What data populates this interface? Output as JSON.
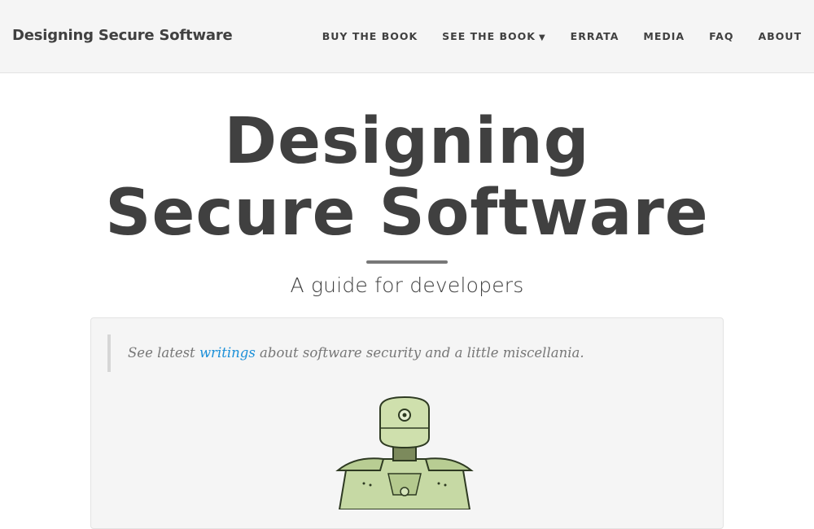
{
  "navbar": {
    "brand": "Designing Secure Software",
    "items": [
      {
        "label": "BUY THE BOOK"
      },
      {
        "label": "SEE THE BOOK",
        "caret": "▼"
      },
      {
        "label": "ERRATA"
      },
      {
        "label": "MEDIA"
      },
      {
        "label": "FAQ"
      },
      {
        "label": "ABOUT"
      }
    ]
  },
  "hero": {
    "title": "Designing Secure Software",
    "subtitle": "A guide for developers"
  },
  "card": {
    "quote_prefix": "See latest ",
    "quote_link": "writings",
    "quote_suffix": " about software security and a little miscellania."
  },
  "colors": {
    "navbar_bg": "#f5f5f5",
    "text": "#404040",
    "link": "#1a8fd8",
    "robot_green": "#c6d9a4"
  }
}
